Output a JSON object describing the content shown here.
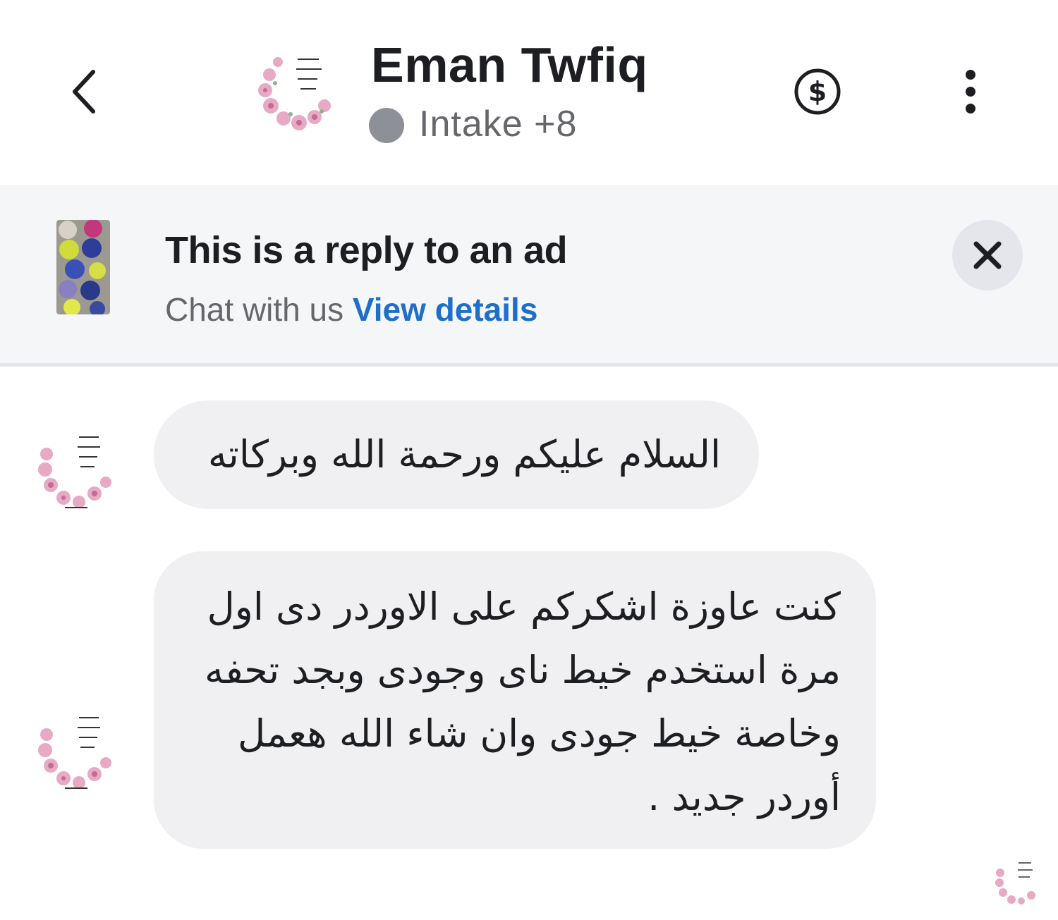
{
  "header": {
    "contact_name": "Eman Twfiq",
    "status_label": "Intake +8",
    "status_color": "#8d9096",
    "icons": {
      "back": "chevron-left-icon",
      "payment": "dollar-circle-icon",
      "more": "more-vertical-icon"
    }
  },
  "ad_banner": {
    "title": "This is a reply to an ad",
    "subtitle": "Chat with us",
    "link_label": "View details",
    "link_color": "#1e6fc9",
    "close_icon": "close-icon"
  },
  "messages": [
    {
      "sender": "Eman Twfiq",
      "text": "السلام عليكم ورحمة الله وبركاته"
    },
    {
      "sender": "Eman Twfiq",
      "text": "كنت عاوزة اشكركم على الاوردر دى اول مرة استخدم خيط ناى وجودى وبجد تحفه وخاصة خيط جودى وان شاء الله هعمل أوردر جديد ."
    }
  ],
  "colors": {
    "bubble_bg": "#f0f0f2",
    "banner_bg": "#f5f6f8",
    "text_primary": "#1c1e21",
    "text_secondary": "#65676b"
  }
}
